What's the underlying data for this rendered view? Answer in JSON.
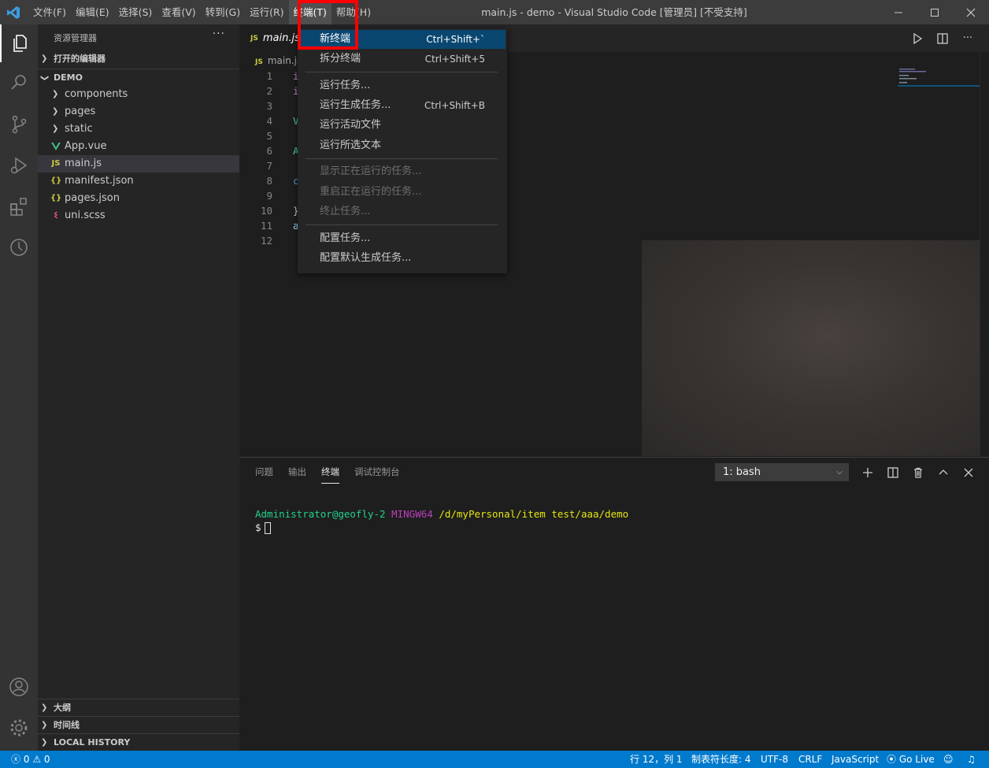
{
  "window": {
    "title": "main.js - demo - Visual Studio Code [管理员] [不受支持]",
    "menu": [
      "文件(F)",
      "编辑(E)",
      "选择(S)",
      "查看(V)",
      "转到(G)",
      "运行(R)",
      "终端(T)",
      "帮助(H)"
    ],
    "active_menu": "终端(T)",
    "controls": [
      "minimize-icon",
      "maximize-icon",
      "close-icon"
    ]
  },
  "activity_bar": [
    "explorer-icon",
    "search-icon",
    "source-control-icon",
    "run-debug-icon",
    "extensions-icon",
    "timeline-icon",
    "account-icon",
    "settings-gear-icon"
  ],
  "sidebar": {
    "title": "资源管理器",
    "more": "···",
    "open_editors": "打开的编辑器",
    "folder": "DEMO",
    "items": [
      {
        "label": "components",
        "type": "folder"
      },
      {
        "label": "pages",
        "type": "folder"
      },
      {
        "label": "static",
        "type": "folder"
      },
      {
        "label": "App.vue",
        "type": "vue"
      },
      {
        "label": "main.js",
        "type": "js",
        "selected": true
      },
      {
        "label": "manifest.json",
        "type": "json"
      },
      {
        "label": "pages.json",
        "type": "json"
      },
      {
        "label": "uni.scss",
        "type": "scss"
      }
    ],
    "outline": "大纲",
    "timeline": "时间线",
    "local_history": "LOCAL HISTORY"
  },
  "editor": {
    "tab_label": "main.js",
    "tab_badge": "JS",
    "breadcrumb": "main.js",
    "breadcrumb_badge": "JS",
    "line_numbers": [
      "1",
      "2",
      "3",
      "4",
      "5",
      "6",
      "7",
      "8",
      "9",
      "10",
      "11",
      "12"
    ],
    "visible_code": [
      {
        "text": "i",
        "color": "#c586c0"
      },
      {
        "text": "i",
        "color": "#c586c0"
      },
      {
        "text": "",
        "color": "#d4d4d4"
      },
      {
        "text": "V",
        "color": "#4ec9b0"
      },
      {
        "text": "",
        "color": "#d4d4d4"
      },
      {
        "text": "A",
        "color": "#4ec9b0"
      },
      {
        "text": "",
        "color": "#d4d4d4"
      },
      {
        "text": "c",
        "color": "#569cd6"
      },
      {
        "text": "",
        "color": "#d4d4d4"
      },
      {
        "text": "}",
        "color": "#d4d4d4"
      },
      {
        "text": "a",
        "color": "#9cdcfe"
      },
      {
        "text": "",
        "color": "#d4d4d4"
      }
    ]
  },
  "terminal_menu": {
    "items": [
      {
        "label": "新终端",
        "shortcut": "Ctrl+Shift+`",
        "highlighted": true
      },
      {
        "label": "拆分终端",
        "shortcut": "Ctrl+Shift+5"
      },
      {
        "label": "运行任务...",
        "shortcut": ""
      },
      {
        "label": "运行生成任务...",
        "shortcut": "Ctrl+Shift+B"
      },
      {
        "label": "运行活动文件",
        "shortcut": ""
      },
      {
        "label": "运行所选文本",
        "shortcut": ""
      },
      {
        "label": "显示正在运行的任务...",
        "shortcut": "",
        "disabled": true
      },
      {
        "label": "重启正在运行的任务...",
        "shortcut": "",
        "disabled": true
      },
      {
        "label": "终止任务...",
        "shortcut": "",
        "disabled": true
      },
      {
        "label": "配置任务...",
        "shortcut": ""
      },
      {
        "label": "配置默认生成任务...",
        "shortcut": ""
      }
    ]
  },
  "panel": {
    "tabs": [
      "问题",
      "输出",
      "终端",
      "调试控制台"
    ],
    "active_tab": "终端",
    "terminal_select": "1: bash",
    "prompt_user": "Administrator@geofly-2",
    "prompt_env": "MINGW64",
    "prompt_path": "/d/myPersonal/item test/aaa/demo",
    "prompt_symbol": "$"
  },
  "statusbar": {
    "errors": "0",
    "warnings": "0",
    "position": "行 12，列 1",
    "tab_size": "制表符长度: 4",
    "encoding": "UTF-8",
    "eol": "CRLF",
    "language": "JavaScript",
    "go_live": "Go Live"
  },
  "colors": {
    "accent": "#007acc",
    "highlight_border": "#ff0000",
    "menu_hover": "#094771",
    "vue_green": "#41b883",
    "js_yellow": "#cbcb41",
    "prompt_green": "#23d18b",
    "prompt_magenta": "#bc3fbc",
    "prompt_yellow": "#e5e510"
  }
}
